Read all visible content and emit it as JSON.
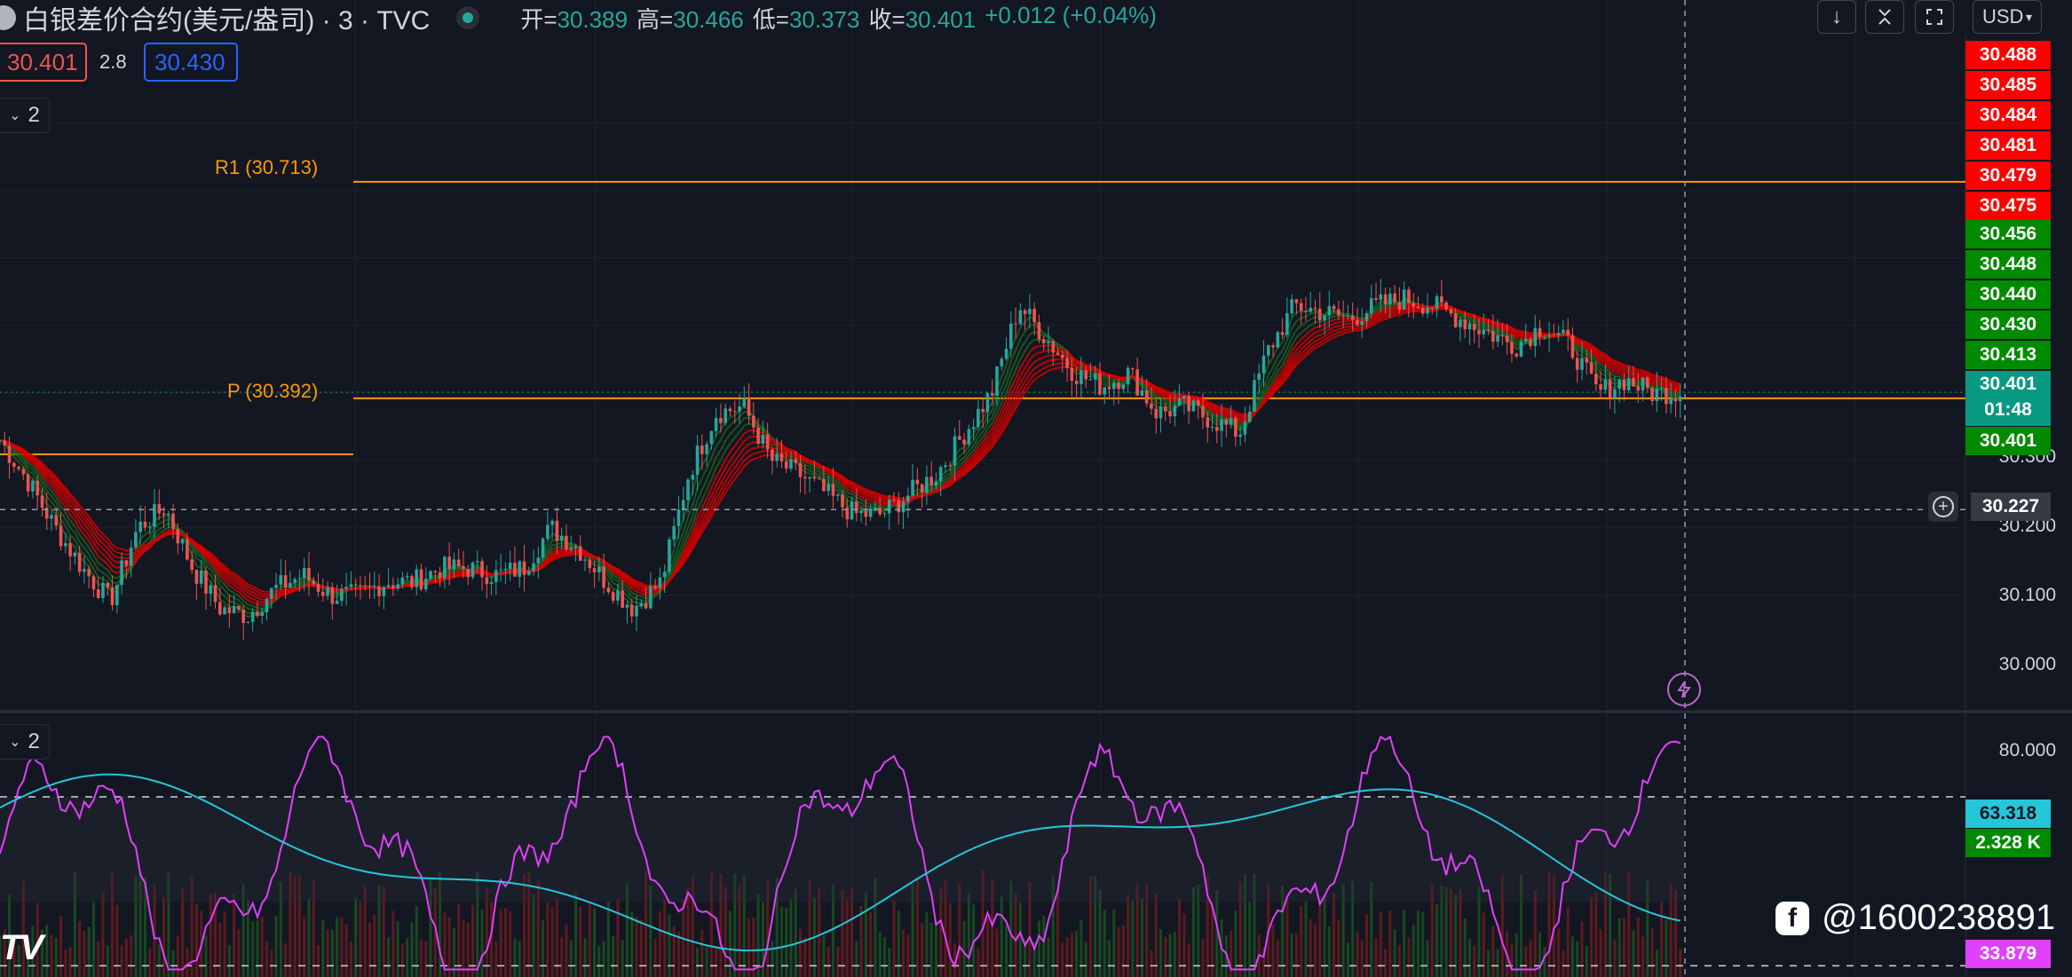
{
  "header": {
    "title": "白银差价合约(美元/盎司) · 3 · TVC",
    "ohlc": [
      {
        "k": "开=",
        "v": "30.389"
      },
      {
        "k": "高=",
        "v": "30.466"
      },
      {
        "k": "低=",
        "v": "30.373"
      },
      {
        "k": "收=",
        "v": "30.401"
      }
    ],
    "change": "+0.012 (+0.04%)"
  },
  "toolbar": {
    "down_icon": "arrow-down-icon",
    "collapse_icon": "collapse-arrows-icon",
    "fullscreen_icon": "fullscreen-icon",
    "currency": "USD"
  },
  "quote": {
    "bid": "30.401",
    "spread": "2.8",
    "ask": "30.430"
  },
  "panes": {
    "main_count": "2",
    "osc_count": "2"
  },
  "pivots": [
    {
      "label": "R1 (30.713)",
      "value": 30.713
    },
    {
      "label": "P (30.392)",
      "value": 30.392
    },
    {
      "label": "",
      "value": 30.309
    }
  ],
  "price_scale": {
    "ticks": [
      "30.300",
      "30.200",
      "30.100",
      "30.000"
    ],
    "red_labels": [
      "30.488",
      "30.485",
      "30.484",
      "30.481",
      "30.479",
      "30.475"
    ],
    "green_labels": [
      "30.456",
      "30.448",
      "30.440",
      "30.430",
      "30.413"
    ],
    "last_price": "30.401",
    "countdown": "01:48",
    "last_price_2": "30.401",
    "crosshair_price": "30.227"
  },
  "osc_scale": {
    "tick": "80.000",
    "cyan_label": "63.318",
    "volume_label": "2.328 K",
    "magenta_label": "33.879"
  },
  "watermark": "@1600238891",
  "colors": {
    "background": "#131722",
    "up": "#26a69a",
    "down": "#ef5350",
    "pivot": "#ff9800",
    "ema_fast": "#1b5e20",
    "ema_slow": "#d50000",
    "cyan": "#26c6da",
    "magenta": "#e040fb",
    "label_red": "#ff0000",
    "label_green": "#008a00"
  },
  "chart_data": {
    "type": "candlestick",
    "symbol": "白银差价合约(美元/盎司)",
    "interval": "3",
    "ylim": [
      29.93,
      30.93
    ],
    "candles": [
      {
        "t": 0,
        "c": 30.33
      },
      {
        "t": 1,
        "c": 30.27
      },
      {
        "t": 2,
        "c": 30.2
      },
      {
        "t": 3,
        "c": 30.14
      },
      {
        "t": 4,
        "c": 30.09
      },
      {
        "t": 5,
        "c": 30.2
      },
      {
        "t": 6,
        "c": 30.23
      },
      {
        "t": 7,
        "c": 30.14
      },
      {
        "t": 8,
        "c": 30.08
      },
      {
        "t": 9,
        "c": 30.07
      },
      {
        "t": 10,
        "c": 30.11
      },
      {
        "t": 11,
        "c": 30.13
      },
      {
        "t": 12,
        "c": 30.1
      },
      {
        "t": 13,
        "c": 30.1
      },
      {
        "t": 14,
        "c": 30.12
      },
      {
        "t": 15,
        "c": 30.12
      },
      {
        "t": 16,
        "c": 30.14
      },
      {
        "t": 17,
        "c": 30.14
      },
      {
        "t": 18,
        "c": 30.13
      },
      {
        "t": 19,
        "c": 30.14
      },
      {
        "t": 20,
        "c": 30.2
      },
      {
        "t": 21,
        "c": 30.17
      },
      {
        "t": 22,
        "c": 30.12
      },
      {
        "t": 23,
        "c": 30.08
      },
      {
        "t": 24,
        "c": 30.12
      },
      {
        "t": 25,
        "c": 30.28
      },
      {
        "t": 26,
        "c": 30.37
      },
      {
        "t": 27,
        "c": 30.38
      },
      {
        "t": 28,
        "c": 30.3
      },
      {
        "t": 29,
        "c": 30.28
      },
      {
        "t": 30,
        "c": 30.25
      },
      {
        "t": 31,
        "c": 30.22
      },
      {
        "t": 32,
        "c": 30.22
      },
      {
        "t": 33,
        "c": 30.25
      },
      {
        "t": 34,
        "c": 30.28
      },
      {
        "t": 35,
        "c": 30.34
      },
      {
        "t": 36,
        "c": 30.4
      },
      {
        "t": 37,
        "c": 30.53
      },
      {
        "t": 38,
        "c": 30.48
      },
      {
        "t": 39,
        "c": 30.43
      },
      {
        "t": 40,
        "c": 30.41
      },
      {
        "t": 41,
        "c": 30.43
      },
      {
        "t": 42,
        "c": 30.37
      },
      {
        "t": 43,
        "c": 30.38
      },
      {
        "t": 44,
        "c": 30.36
      },
      {
        "t": 45,
        "c": 30.34
      },
      {
        "t": 46,
        "c": 30.46
      },
      {
        "t": 47,
        "c": 30.53
      },
      {
        "t": 48,
        "c": 30.52
      },
      {
        "t": 49,
        "c": 30.51
      },
      {
        "t": 50,
        "c": 30.53
      },
      {
        "t": 51,
        "c": 30.54
      },
      {
        "t": 52,
        "c": 30.53
      },
      {
        "t": 53,
        "c": 30.51
      },
      {
        "t": 54,
        "c": 30.49
      },
      {
        "t": 55,
        "c": 30.47
      },
      {
        "t": 56,
        "c": 30.5
      },
      {
        "t": 57,
        "c": 30.47
      },
      {
        "t": 58,
        "c": 30.4
      },
      {
        "t": 59,
        "c": 30.42
      },
      {
        "t": 60,
        "c": 30.4
      },
      {
        "t": 61,
        "c": 30.401
      }
    ],
    "pivots": {
      "R1": 30.713,
      "P": 30.392
    },
    "oscillator": {
      "range": [
        20,
        90
      ],
      "tick": 80,
      "cyan_last": 63.318,
      "magenta_last": 33.879,
      "volume_last": "2.328 K"
    }
  }
}
